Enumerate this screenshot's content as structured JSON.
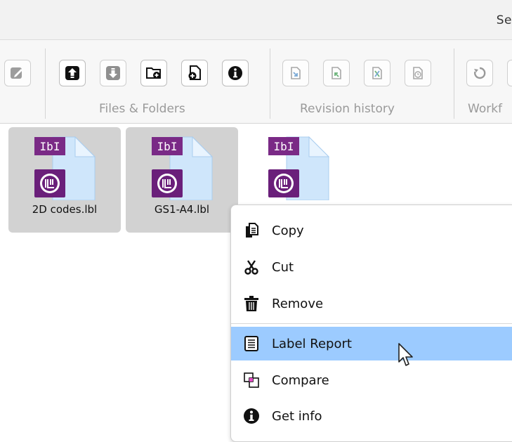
{
  "topbar": {
    "text": "Se"
  },
  "ribbon": {
    "groups": {
      "files": "Files & Folders",
      "revision": "Revision history",
      "workflow": "Workf"
    },
    "buttons": [
      "edit-icon",
      "upload-icon",
      "download-icon",
      "new-folder-icon",
      "new-file-icon",
      "info-icon",
      "checkin-icon",
      "checkout-icon",
      "undo-checkout-icon",
      "history-icon",
      "workflow-icon"
    ]
  },
  "files": [
    {
      "name": "2D codes.lbl",
      "badge": "lbl",
      "selected": true
    },
    {
      "name": "GS1-A4.lbl",
      "badge": "lbl",
      "selected": true
    },
    {
      "name": "",
      "badge": "lbl",
      "selected": false
    }
  ],
  "context_menu": {
    "items": [
      {
        "label": "Copy",
        "icon": "copy-icon"
      },
      {
        "label": "Cut",
        "icon": "scissors-icon"
      },
      {
        "label": "Remove",
        "icon": "trash-icon"
      },
      {
        "label": "Label Report",
        "icon": "report-icon",
        "highlighted": true
      },
      {
        "label": "Compare",
        "icon": "compare-icon"
      },
      {
        "label": "Get info",
        "icon": "info-icon"
      }
    ]
  },
  "colors": {
    "highlight": "#9ccbff",
    "badge": "#6a1f7a",
    "selection": "#d2d2d2"
  }
}
